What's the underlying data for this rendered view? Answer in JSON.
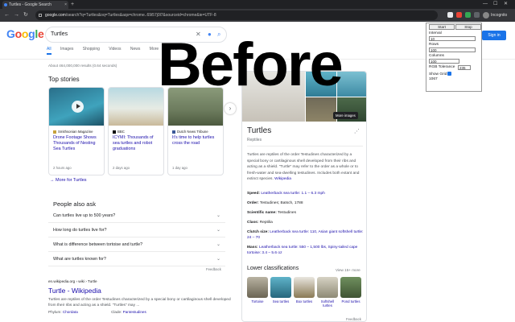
{
  "browser": {
    "tab_title": "Turtles - Google Search",
    "tab_close": "×",
    "new_tab": "+",
    "url_domain": "google.com",
    "url_path": "/search?q=Turtles&oq=Turtles&aqs=chrome..69i57j0l7&sourceid=chrome&ie=UTF-8",
    "back": "←",
    "forward": "→",
    "reload": "↻",
    "incognito_label": "Incognito",
    "window_controls": [
      "—",
      "☐",
      "✕"
    ]
  },
  "google": {
    "logo_letters": [
      {
        "ch": "G",
        "color": "#4285f4"
      },
      {
        "ch": "o",
        "color": "#ea4335"
      },
      {
        "ch": "o",
        "color": "#fbbc05"
      },
      {
        "ch": "g",
        "color": "#4285f4"
      },
      {
        "ch": "l",
        "color": "#34a853"
      },
      {
        "ch": "e",
        "color": "#ea4335"
      }
    ],
    "query": "Turtles",
    "sign_in": "Sign in",
    "tabs": [
      "All",
      "Images",
      "Shopping",
      "Videos",
      "News",
      "More",
      "Tools"
    ],
    "stats": "About 464,000,000 results (0.64 seconds)",
    "accent": "#1a73e8"
  },
  "top_stories": {
    "heading": "Top stories",
    "cards": [
      {
        "source": "Smithsonian Magazine",
        "title": "Drone Footage Shows Thousands of Nesting Sea Turtles",
        "age": "2 hours ago"
      },
      {
        "source": "BBC",
        "title": "ICYMI: Thousands of sea turtles and robot graduations",
        "age": "2 days ago"
      },
      {
        "source": "Dutch News Tribune",
        "title": "It's time to help turtles cross the road",
        "age": "1 day ago"
      }
    ],
    "more": "More for Turtles"
  },
  "people_also_ask": {
    "heading": "People also ask",
    "questions": [
      "Can turtles live up to 500 years?",
      "How long do turtles live for?",
      "What is difference between tortoise and turtle?",
      "What are turtles known for?"
    ],
    "feedback": "Feedback"
  },
  "result": {
    "url": "en.wikipedia.org › wiki › Turtle",
    "title": "Turtle - Wikipedia",
    "snippet": "Turtles are reptiles of the order Testudines characterized by a special bony or cartilaginous shell developed from their ribs and acting as a shield. \"Turtles\" may ...",
    "phylum_label": "Phylum:",
    "phylum_value": "Chordata",
    "clade_label": "Clade:",
    "clade_value": "Pantestudines"
  },
  "knowledge_panel": {
    "title": "Turtles",
    "subtitle": "Reptiles",
    "more_images": "More images",
    "description": "Turtles are reptiles of the order Testudines characterized by a special bony or cartilaginous shell developed from their ribs and acting as a shield. \"Turtle\" may refer to the order as a whole or to fresh-water and sea-dwelling testudines. Includes both extant and extinct species.",
    "desc_link": "Wikipedia",
    "facts": [
      {
        "label": "Speed:",
        "value": "Leatherback sea turtle: 1.1 – 6.3 mph"
      },
      {
        "label": "Order:",
        "value": "Testudines; Batsch, 1788"
      },
      {
        "label": "Scientific name:",
        "value": "Testudines"
      },
      {
        "label": "Class:",
        "value": "Reptilia"
      },
      {
        "label": "Clutch size:",
        "value": "Leatherback sea turtle: 110, Asian giant softshell turtle: 24 – 70"
      },
      {
        "label": "Mass:",
        "value": "Leatherback sea turtle: 550 – 1,500 lbs, Spiny-tailed cape tortoise: 3.4 – 5.6 oz"
      }
    ],
    "lower_title": "Lower classifications",
    "lower_more": "View 15+ more",
    "lower_items": [
      "Tortoise",
      "Sea turtles",
      "Box turtles",
      "Softshell turtles",
      "Pond turtles"
    ],
    "feedback": "Feedback"
  },
  "overlay": {
    "text": "Before"
  },
  "extension_popup": {
    "start": "Start",
    "stop": "Stop",
    "interval_label": "Interval",
    "interval_value": "10",
    "rows_label": "Rows",
    "rows_value": "100",
    "columns_label": "Columns",
    "columns_value": "100",
    "rgb_label": "RGB Tolerance",
    "rgb_value": "235",
    "show_grid_label": "Show Grid",
    "count": "1067"
  }
}
